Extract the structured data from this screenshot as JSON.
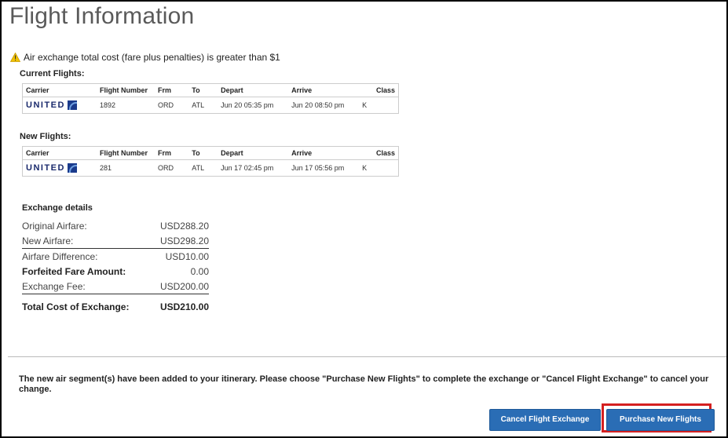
{
  "page": {
    "title": "Flight Information",
    "warning": "Air exchange total cost (fare plus penalties) is greater than $1"
  },
  "current": {
    "label": "Current Flights:",
    "headers": [
      "Carrier",
      "Flight Number",
      "Frm",
      "To",
      "Depart",
      "Arrive",
      "Class"
    ],
    "rows": [
      {
        "carrier": "UNITED",
        "flight": "1892",
        "from": "ORD",
        "to": "ATL",
        "depart": "Jun 20 05:35 pm",
        "arrive": "Jun 20 08:50 pm",
        "class": "K"
      }
    ]
  },
  "new": {
    "label": "New Flights:",
    "headers": [
      "Carrier",
      "Flight Number",
      "Frm",
      "To",
      "Depart",
      "Arrive",
      "Class"
    ],
    "rows": [
      {
        "carrier": "UNITED",
        "flight": "281",
        "from": "ORD",
        "to": "ATL",
        "depart": "Jun 17 02:45 pm",
        "arrive": "Jun 17 05:56 pm",
        "class": "K"
      }
    ]
  },
  "exchange": {
    "title": "Exchange details",
    "rows": [
      {
        "label": "Original Airfare:",
        "value": "USD288.20"
      },
      {
        "label": "New Airfare:",
        "value": "USD298.20"
      },
      {
        "label": "Airfare Difference:",
        "value": "USD10.00"
      },
      {
        "label": "Forfeited Fare Amount:",
        "value": "0.00"
      },
      {
        "label": "Exchange Fee:",
        "value": "USD200.00"
      }
    ],
    "total_label": "Total Cost of Exchange:",
    "total_value": "USD210.00"
  },
  "footer": {
    "message": "The new air segment(s) have been added to your itinerary. Please choose \"Purchase New Flights\" to complete the exchange or \"Cancel Flight Exchange\" to cancel your change.",
    "cancel_label": "Cancel Flight Exchange",
    "purchase_label": "Purchase New Flights",
    "highlight_color": "#d42020"
  }
}
